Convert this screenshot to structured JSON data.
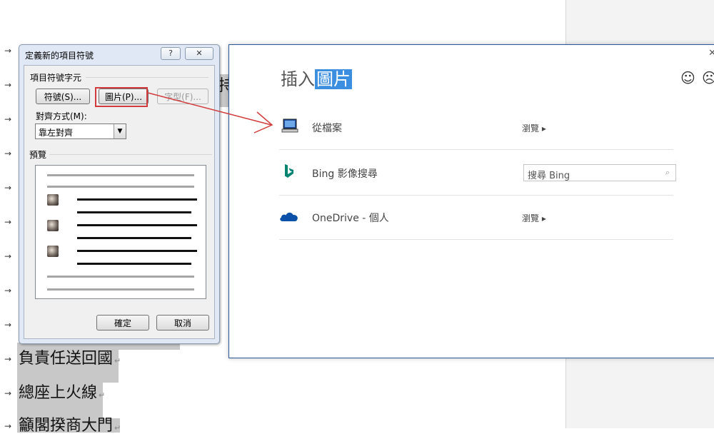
{
  "document": {
    "arrow_glyph": "→",
    "para_mark": "↵",
    "lines": [
      "負責任送回國",
      "總座上火線",
      "籲閣揆商大門"
    ],
    "partial_char": "持"
  },
  "dialog": {
    "title": "定義新的項目符號",
    "help_glyph": "?",
    "close_glyph": "✕",
    "group_label": "項目符號字元",
    "symbol_button": "符號(S)...",
    "picture_button": "圖片(P)...",
    "font_button": "字型(F)...",
    "alignment_label": "對齊方式(M):",
    "alignment_value": "靠左對齊",
    "combo_arrow": "▼",
    "preview_label": "預覽",
    "ok_button": "確定",
    "cancel_button": "取消"
  },
  "insert_pictures": {
    "title_plain": "插入",
    "title_selected": "圖片",
    "close_glyph": "✕",
    "smile_glyph": "☺",
    "frown_glyph": "☹",
    "rows": [
      {
        "label": "從檔案",
        "icon": "computer-icon",
        "action": "瀏覽 ▸"
      },
      {
        "label": "Bing 影像搜尋",
        "icon": "bing-icon",
        "search_placeholder": "搜尋 Bing"
      },
      {
        "label": "OneDrive - 個人",
        "icon": "onedrive-icon",
        "action": "瀏覽 ▸"
      }
    ],
    "search_icon": "⌕"
  },
  "colors": {
    "accent_blue": "#2b579a",
    "annotation_red": "#d23b3b",
    "bing_teal": "#008373",
    "onedrive_blue": "#0a4fa8"
  }
}
